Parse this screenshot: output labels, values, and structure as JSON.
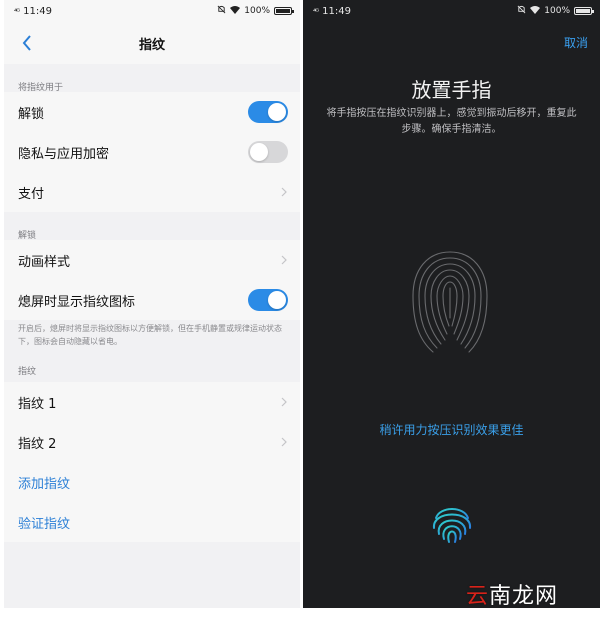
{
  "left": {
    "status": {
      "signal": "⁴ᴳ",
      "time": "11:49",
      "battery": "100%"
    },
    "nav": {
      "title": "指纹"
    },
    "sections": [
      {
        "header": "将指纹用于"
      },
      {
        "header": "解锁"
      },
      {
        "header": "指纹"
      }
    ],
    "rows": {
      "unlock": {
        "label": "解锁",
        "toggle": "on"
      },
      "privacy": {
        "label": "隐私与应用加密",
        "toggle": "off"
      },
      "payment": {
        "label": "支付"
      },
      "animation": {
        "label": "动画样式"
      },
      "screen_off_icon": {
        "label": "熄屏时显示指纹图标",
        "toggle": "on"
      },
      "fingerprint1": {
        "label": "指纹 1"
      },
      "fingerprint2": {
        "label": "指纹 2"
      },
      "add_fingerprint": {
        "label": "添加指纹"
      },
      "verify_fingerprint": {
        "label": "验证指纹"
      }
    },
    "note": "开启后，熄屏时将显示指纹图标以方便解锁，但在手机静置或规律运动状态下，图标会自动隐藏以省电。"
  },
  "right": {
    "status": {
      "signal": "⁴ᴳ",
      "time": "11:49",
      "battery": "100%"
    },
    "cancel": "取消",
    "title": "放置手指",
    "description": "将手指按压在指纹识别器上，感觉到振动后移开，重复此步骤。确保手指清洁。",
    "hint": "稍许用力按压识别效果更佳"
  },
  "watermark": {
    "first": "云",
    "rest": "南龙网"
  },
  "colors": {
    "accent": "#2b8be6",
    "link": "#2b7fd6",
    "dark_bg": "#1d1e20",
    "hint": "#3a9fe8"
  }
}
